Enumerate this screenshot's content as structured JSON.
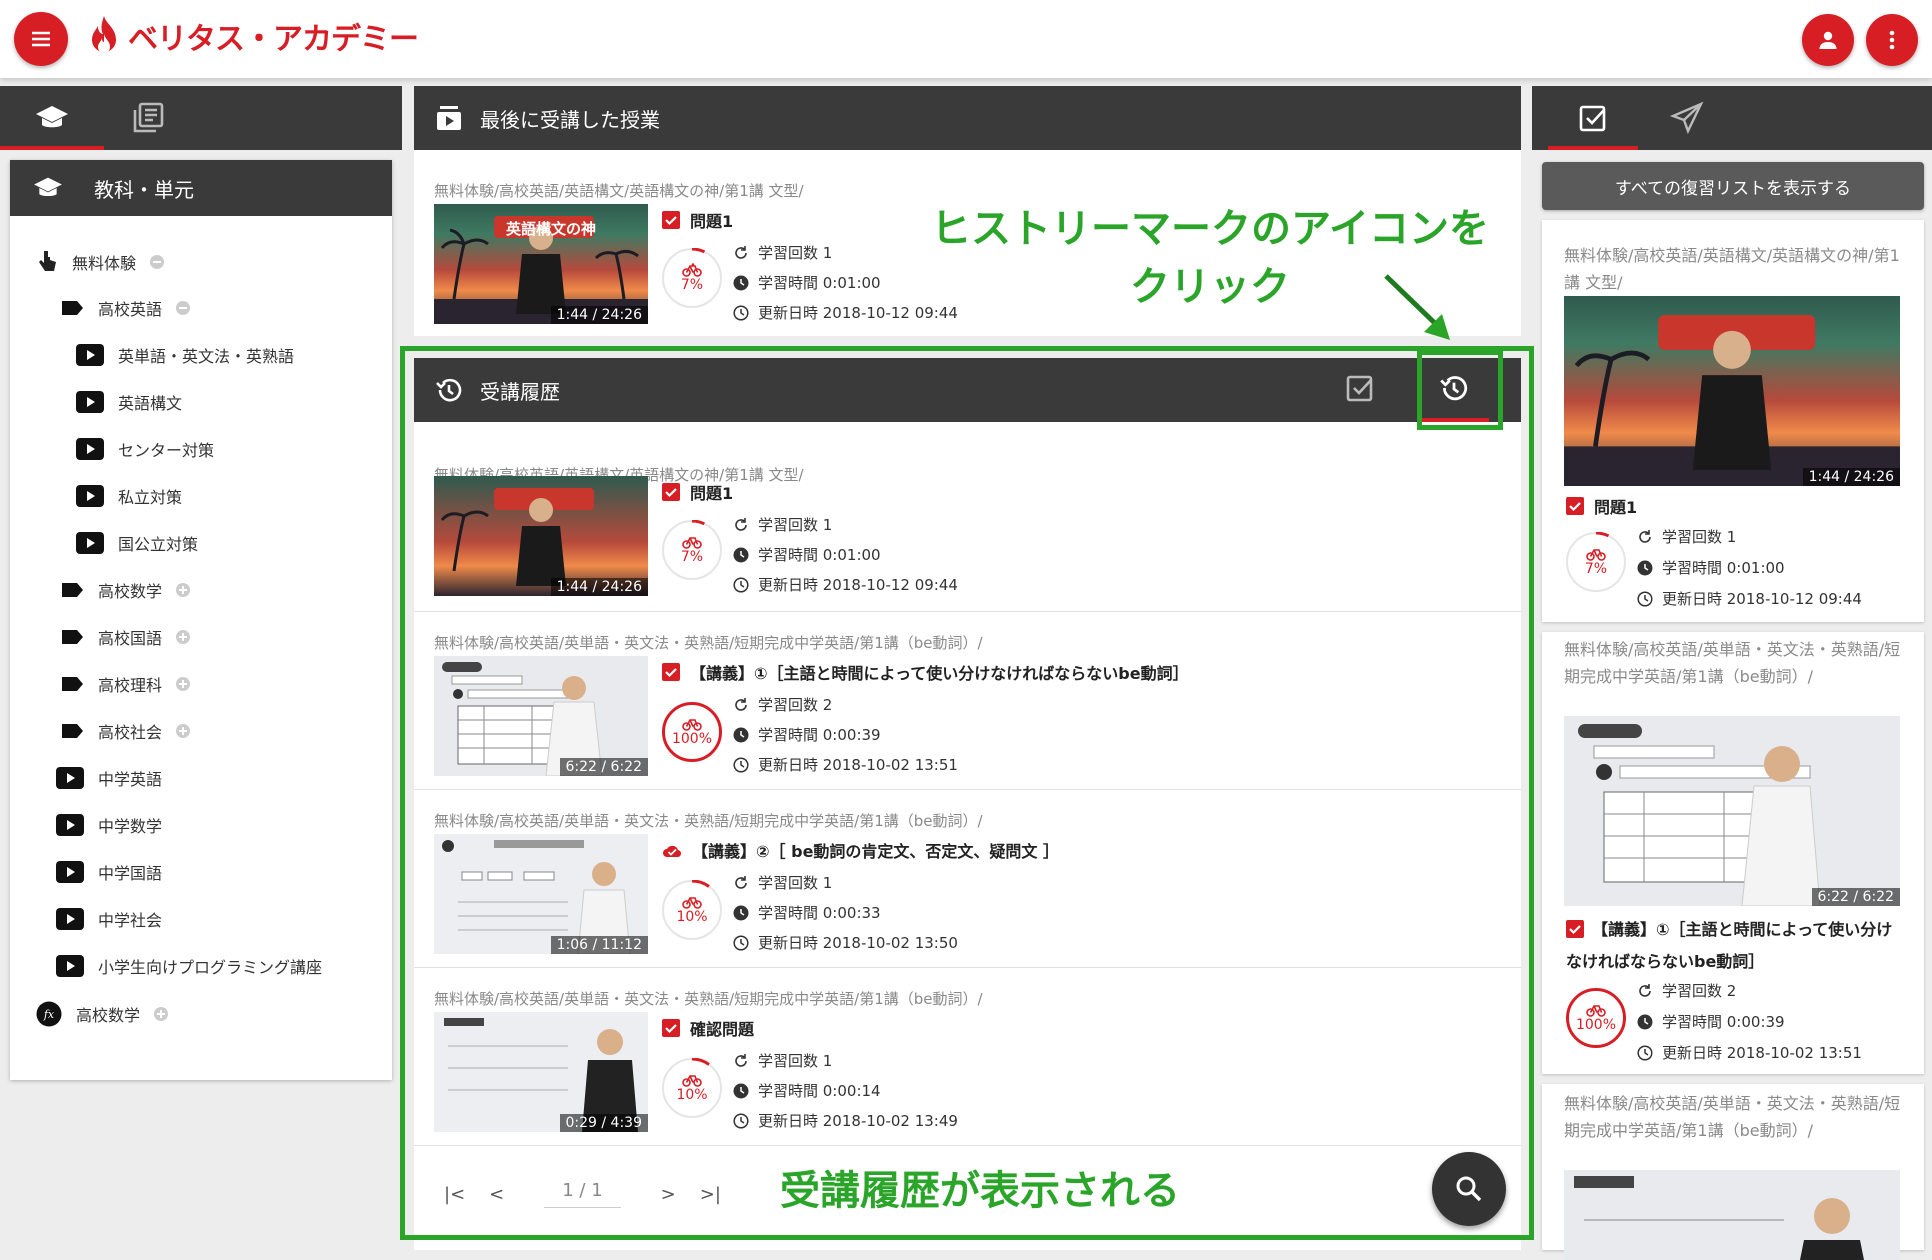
{
  "header": {
    "logo_text": "ベリタス・アカデミー",
    "brand_color": "#d81e25"
  },
  "left": {
    "section_title": "教科・単元",
    "tree": [
      {
        "label": "無料体験",
        "level": 0,
        "icon": "hand-pointer-icon",
        "toggle": "minus"
      },
      {
        "label": "高校英語",
        "level": 1,
        "icon": "tag-icon",
        "toggle": "minus"
      },
      {
        "label": "英単語・英文法・英熟語",
        "level": 2,
        "icon": "play-icon",
        "toggle": ""
      },
      {
        "label": "英語構文",
        "level": 2,
        "icon": "play-icon",
        "toggle": ""
      },
      {
        "label": "センター対策",
        "level": 2,
        "icon": "play-icon",
        "toggle": ""
      },
      {
        "label": "私立対策",
        "level": 2,
        "icon": "play-icon",
        "toggle": ""
      },
      {
        "label": "国公立対策",
        "level": 2,
        "icon": "play-icon",
        "toggle": ""
      },
      {
        "label": "高校数学",
        "level": 1,
        "icon": "tag-icon",
        "toggle": "plus"
      },
      {
        "label": "高校国語",
        "level": 1,
        "icon": "tag-icon",
        "toggle": "plus"
      },
      {
        "label": "高校理科",
        "level": 1,
        "icon": "tag-icon",
        "toggle": "plus"
      },
      {
        "label": "高校社会",
        "level": 1,
        "icon": "tag-icon",
        "toggle": "plus"
      },
      {
        "label": "中学英語",
        "level": 1,
        "icon": "play-icon",
        "toggle": ""
      },
      {
        "label": "中学数学",
        "level": 1,
        "icon": "play-icon",
        "toggle": ""
      },
      {
        "label": "中学国語",
        "level": 1,
        "icon": "play-icon",
        "toggle": ""
      },
      {
        "label": "中学社会",
        "level": 1,
        "icon": "play-icon",
        "toggle": ""
      },
      {
        "label": "小学生向けプログラミング講座",
        "level": 1,
        "icon": "play-icon",
        "toggle": ""
      },
      {
        "label": "高校数学",
        "level": 0,
        "icon": "function-icon",
        "toggle": "plus"
      }
    ]
  },
  "last_lesson": {
    "title": "最後に受講した授業",
    "path": "無料体験/高校英語/英語構文/英語構文の神/第1講 文型/",
    "question": "問題1",
    "progress": "7%",
    "count": "学習回数 1",
    "time": "学習時間 0:01:00",
    "updated": "更新日時 2018-10-12 09:44",
    "duration": "1:44 / 24:26",
    "banner": "英語構文の神"
  },
  "history": {
    "title": "受講履歴",
    "entries": [
      {
        "path": "無料体験/高校英語/英語構文/英語構文の神/第1講 文型/",
        "question": "問題1",
        "progress": "7%",
        "count": "学習回数 1",
        "time": "学習時間 0:01:00",
        "updated": "更新日時 2018-10-12 09:44",
        "duration": "1:44 / 24:26",
        "status": "check"
      },
      {
        "path": "無料体験/高校英語/英単語・英文法・英熟語/短期完成中学英語/第1講（be動詞）/",
        "question": "【講義】①［主語と時間によって使い分けなければならないbe動詞］",
        "progress": "100%",
        "count": "学習回数 2",
        "time": "学習時間 0:00:39",
        "updated": "更新日時 2018-10-02 13:51",
        "duration": "6:22 / 6:22",
        "status": "check"
      },
      {
        "path": "無料体験/高校英語/英単語・英文法・英熟語/短期完成中学英語/第1講（be動詞）/",
        "question": "【講義】②［ be動詞の肯定文、否定文、疑問文 ］",
        "progress": "10%",
        "count": "学習回数 1",
        "time": "学習時間 0:00:33",
        "updated": "更新日時 2018-10-02 13:50",
        "duration": "1:06 / 11:12",
        "status": "cloud"
      },
      {
        "path": "無料体験/高校英語/英単語・英文法・英熟語/短期完成中学英語/第1講（be動詞）/",
        "question": "確認問題",
        "progress": "10%",
        "count": "学習回数 1",
        "time": "学習時間 0:00:14",
        "updated": "更新日時 2018-10-02 13:49",
        "duration": "0:29 / 4:39",
        "status": "check"
      }
    ],
    "pagination": "1 / 1"
  },
  "review": {
    "show_all_label": "すべての復習リストを表示する",
    "cards": [
      {
        "path": "無料体験/高校英語/英語構文/英語構文の神/第1講 文型/",
        "question": "問題1",
        "progress": "7%",
        "count": "学習回数 1",
        "time": "学習時間 0:01:00",
        "updated": "更新日時 2018-10-12 09:44",
        "duration": "1:44 / 24:26"
      },
      {
        "path": "無料体験/高校英語/英単語・英文法・英熟語/短期完成中学英語/第1講（be動詞）/",
        "question": "【講義】①［主語と時間によって使い分けなければならないbe動詞］",
        "progress": "100%",
        "count": "学習回数 2",
        "time": "学習時間 0:00:39",
        "updated": "更新日時 2018-10-02 13:51",
        "duration": "6:22 / 6:22"
      },
      {
        "path": "無料体験/高校英語/英単語・英文法・英熟語/短期完成中学英語/第1講（be動詞）/",
        "question": "",
        "progress": "",
        "count": "",
        "time": "",
        "updated": "",
        "duration": ""
      }
    ]
  },
  "annotations": {
    "top": "ヒストリーマークのアイコンを\nクリック",
    "bottom": "受講履歴が表示される",
    "color": "#2aa52a"
  }
}
